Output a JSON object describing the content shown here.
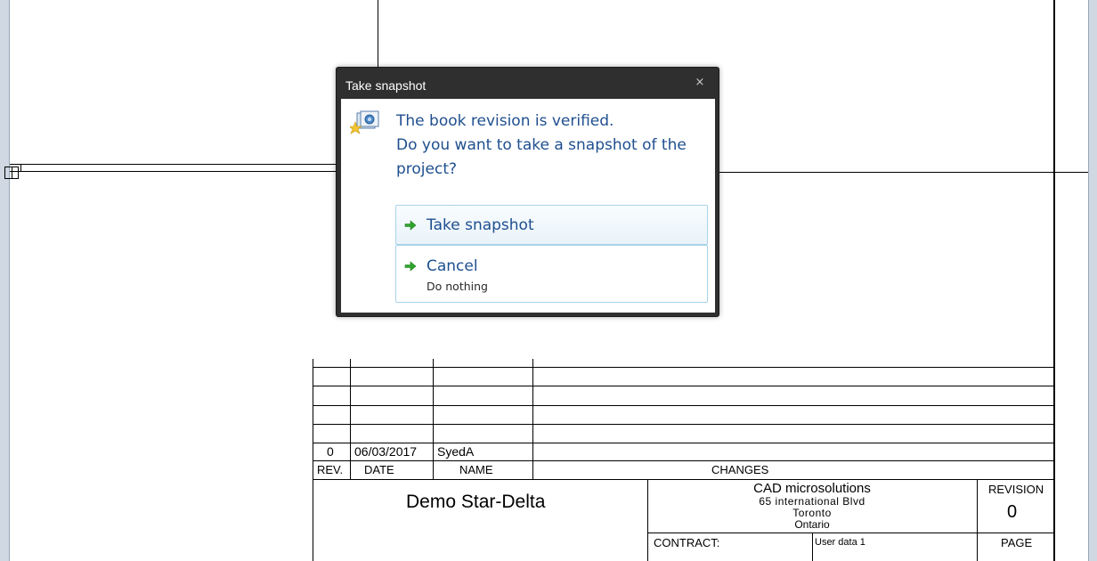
{
  "dialog": {
    "title": "Take snapshot",
    "close_glyph": "×",
    "icon": "snapshot-camera-icon",
    "message_lines": [
      "The book revision is verified.",
      "Do you want to take a snapshot of the",
      "project?"
    ],
    "commands": [
      {
        "label": "Take snapshot",
        "icon": "green-arrow-icon"
      },
      {
        "label": "Cancel",
        "sublabel": "Do nothing",
        "icon": "green-arrow-icon"
      }
    ]
  },
  "title_block": {
    "revision_rows": [
      {
        "rev": "0",
        "date": "06/03/2017",
        "name": "SyedA",
        "changes": ""
      }
    ],
    "headers": {
      "rev": "REV.",
      "date": "DATE",
      "name": "NAME",
      "changes": "CHANGES"
    },
    "project_title": "Demo Star-Delta",
    "company": {
      "name": "CAD microsolutions",
      "address": "65 international Blvd",
      "city": "Toronto",
      "province": "Ontario"
    },
    "revision_label": "REVISION",
    "revision_value": "0",
    "contract_label": "CONTRACT:",
    "user_data_label": "User data 1",
    "page_label": "PAGE"
  },
  "colors": {
    "dialog_bg": "#2f2f2f",
    "accent_text": "#1f4f8f",
    "command_border": "#a7d3ea",
    "arrow": "#2ea52e"
  }
}
